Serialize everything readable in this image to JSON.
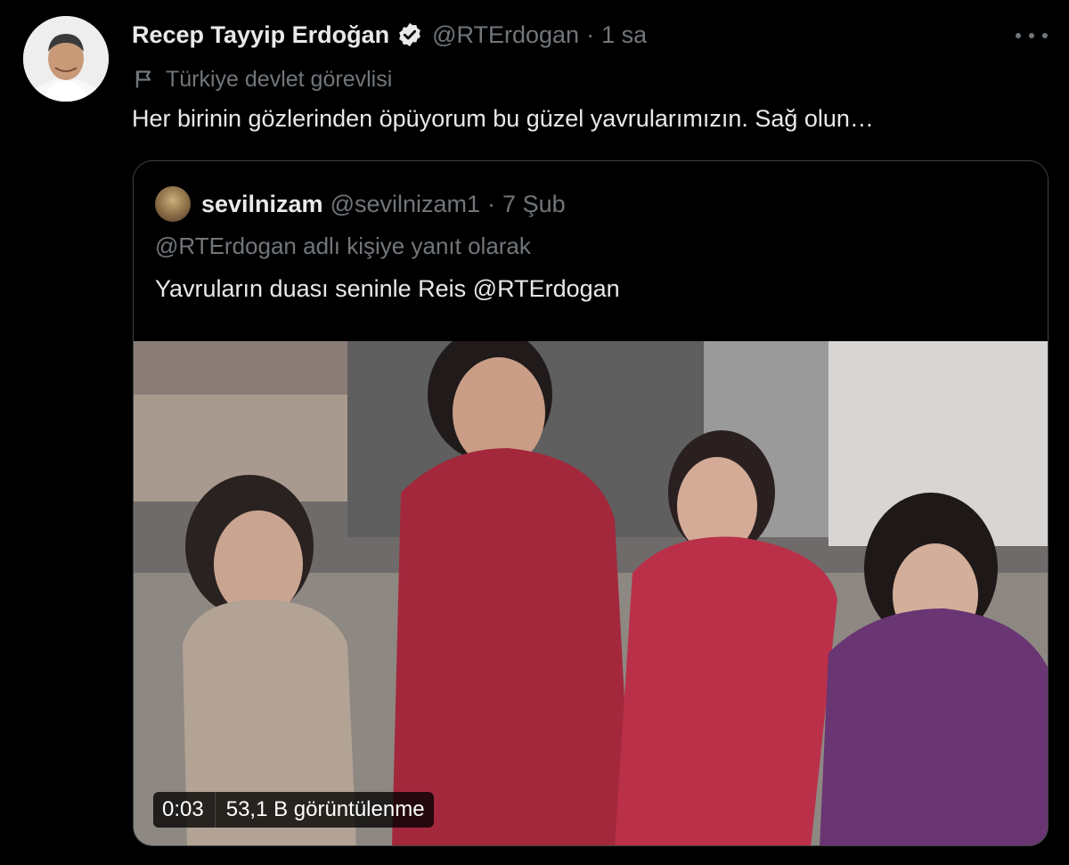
{
  "tweet": {
    "author": {
      "name": "Recep Tayyip Erdoğan",
      "handle": "@RTErdogan",
      "verified": true
    },
    "separator": "·",
    "time": "1 sa",
    "label": "Türkiye devlet görevlisi",
    "text": "Her birinin gözlerinden öpüyorum bu güzel yavrularımızın. Sağ olun…"
  },
  "quote": {
    "author": {
      "name": "sevilnizam",
      "handle": "@sevilnizam1"
    },
    "separator": "·",
    "date": "7 Şub",
    "reply_to": "@RTErdogan adlı kişiye yanıt olarak",
    "text": "Yavruların duası seninle Reis @RTErdogan",
    "video": {
      "duration": "0:03",
      "views": "53,1 B görüntülenme"
    }
  },
  "icons": [
    "verified-badge-icon",
    "flag-icon",
    "more-icon"
  ],
  "colors": {
    "background": "#000000",
    "text_primary": "#e7e9ea",
    "text_muted": "#71767b",
    "border": "#3e4144"
  }
}
